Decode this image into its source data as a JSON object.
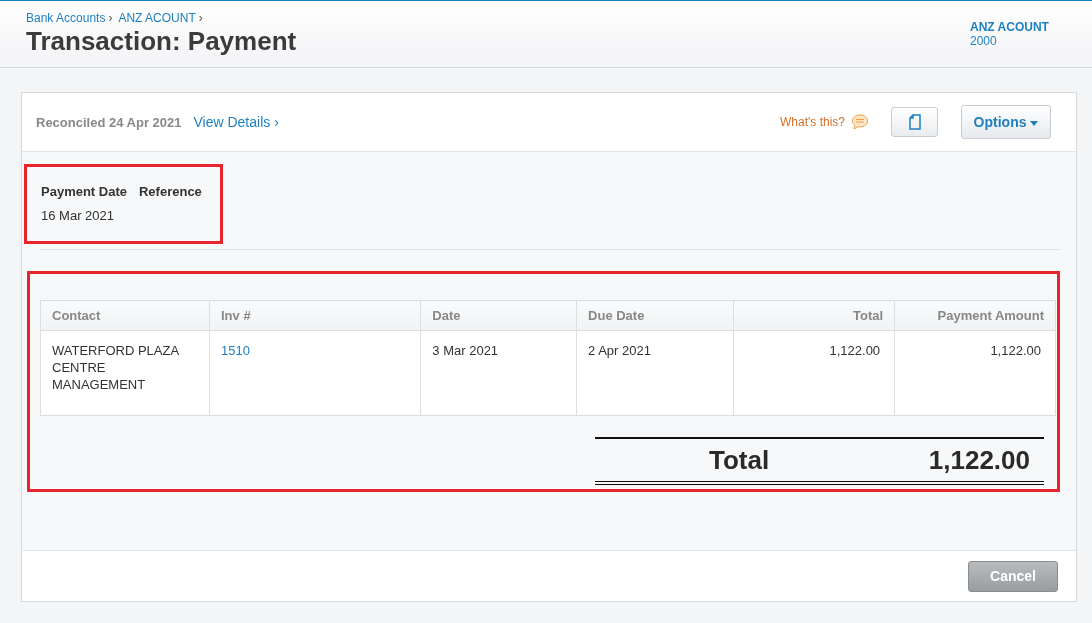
{
  "breadcrumbs": [
    {
      "label": "Bank Accounts",
      "separator": "›"
    },
    {
      "label": "ANZ ACOUNT",
      "separator": "›"
    }
  ],
  "title": "Transaction: Payment",
  "account": {
    "name": "ANZ ACOUNT",
    "number": "2000"
  },
  "status": {
    "text": "Reconciled 24 Apr 2021",
    "link": "View Details ›"
  },
  "help_link": "What's this?",
  "options_button": "Options",
  "payment_info": {
    "labels": [
      "Payment Date",
      "Reference"
    ],
    "values": [
      "16 Mar 2021"
    ]
  },
  "table": {
    "columns": [
      "Contact",
      "Inv #",
      "Date",
      "Due Date",
      "Total",
      "Payment Amount"
    ],
    "rows": [
      [
        {
          "text": "WATERFORD PLAZA CENTRE MANAGEMENT",
          "kind": "text"
        },
        {
          "text": "1510",
          "kind": "link"
        },
        {
          "text": "3 Mar 2021",
          "kind": "text"
        },
        {
          "text": "2 Apr 2021",
          "kind": "text"
        },
        {
          "text": "1,122.00",
          "kind": "text"
        },
        {
          "text": "1,122.00",
          "kind": "text"
        }
      ]
    ]
  },
  "total": {
    "label": "Total",
    "value": "1,122.00"
  },
  "cancel_button": "Cancel"
}
